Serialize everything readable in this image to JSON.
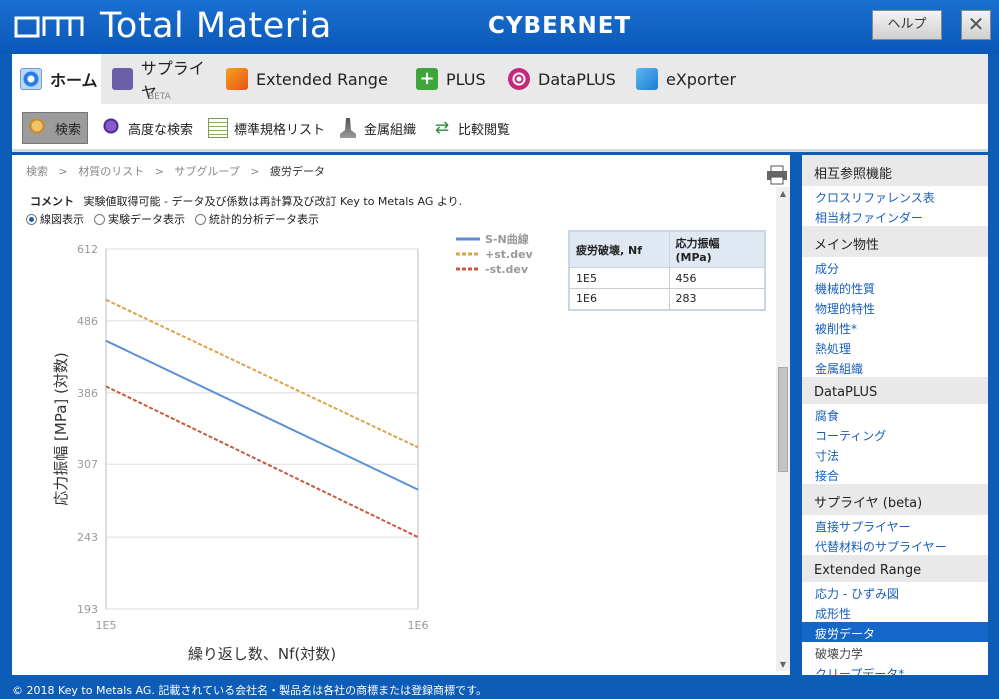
{
  "window": {
    "app_title": "Total Materia",
    "brand": "CYBERNET",
    "help_label": "ヘルプ",
    "close_label": "✕"
  },
  "main_tabs": [
    {
      "label": "ホーム",
      "icon": "home-icon",
      "active": true
    },
    {
      "label": "サプライヤ",
      "icon": "supplier-icon",
      "badge": "BETA"
    },
    {
      "label": "Extended Range",
      "icon": "extended-range-icon"
    },
    {
      "label": "PLUS",
      "icon": "plus-icon"
    },
    {
      "label": "DataPLUS",
      "icon": "dataplus-icon"
    },
    {
      "label": "eXporter",
      "icon": "exporter-icon"
    }
  ],
  "toolbar": [
    {
      "label": "検索",
      "icon": "search-icon",
      "active": true
    },
    {
      "label": "高度な検索",
      "icon": "advanced-search-icon"
    },
    {
      "label": "標準規格リスト",
      "icon": "standards-list-icon"
    },
    {
      "label": "金属組織",
      "icon": "microscope-icon"
    },
    {
      "label": "比較閲覧",
      "icon": "compare-icon"
    }
  ],
  "breadcrumb": [
    "検索",
    "材質のリスト",
    "サブグループ",
    "疲労データ"
  ],
  "comment": {
    "label": "コメント",
    "text": "実験値取得可能 - データ及び係数は再計算及び改訂 Key to Metals AG より."
  },
  "view_options": [
    {
      "label": "線図表示",
      "selected": true
    },
    {
      "label": "実験データ表示",
      "selected": false
    },
    {
      "label": "統計的分析データ表示",
      "selected": false
    }
  ],
  "chart_data": {
    "type": "line",
    "title": "",
    "xlabel": "繰り返し数、Nf(対数)",
    "ylabel": "応力振幅 [MPa] (対数)",
    "x_scale": "log",
    "y_scale": "log",
    "x": [
      "1E5",
      "1E6"
    ],
    "y_ticks": [
      "612",
      "486",
      "386",
      "307",
      "243",
      "193"
    ],
    "ylim": [
      193,
      612
    ],
    "grid": true,
    "legend_position": "top-right",
    "series": [
      {
        "name": "S-N曲線",
        "values": [
          456,
          283
        ],
        "color": "#5b8fd8",
        "dash": "solid"
      },
      {
        "name": "+st.dev",
        "values": [
          520,
          324
        ],
        "color": "#d9a54a",
        "dash": "dashed"
      },
      {
        "name": "-st.dev",
        "values": [
          394,
          243
        ],
        "color": "#c85a3c",
        "dash": "dashed"
      }
    ]
  },
  "data_table": {
    "headers": [
      "疲労破壊, Nf",
      "応力振幅 (MPa)"
    ],
    "rows": [
      [
        "1E5",
        "456"
      ],
      [
        "1E6",
        "283"
      ]
    ]
  },
  "sidebar": [
    {
      "header": "相互参照機能",
      "items": [
        {
          "label": "クロスリファレンス表"
        },
        {
          "label": "相当材ファインダー"
        }
      ]
    },
    {
      "header": "メイン物性",
      "items": [
        {
          "label": "成分"
        },
        {
          "label": "機械的性質"
        },
        {
          "label": "物理的特性"
        },
        {
          "label": "被削性*"
        },
        {
          "label": "熱処理"
        },
        {
          "label": "金属組織"
        }
      ]
    },
    {
      "header": "DataPLUS",
      "items": [
        {
          "label": "腐食"
        },
        {
          "label": "コーティング"
        },
        {
          "label": "寸法"
        },
        {
          "label": "接合"
        }
      ]
    },
    {
      "header": "サプライヤ (beta)",
      "items": [
        {
          "label": "直接サプライヤー"
        },
        {
          "label": "代替材料のサプライヤー"
        }
      ]
    },
    {
      "header": "Extended Range",
      "items": [
        {
          "label": "応力 - ひずみ図"
        },
        {
          "label": "成形性"
        },
        {
          "label": "疲労データ",
          "selected": true
        },
        {
          "label": "破壊力学",
          "muted": true
        },
        {
          "label": "クリープデータ*"
        }
      ]
    }
  ],
  "footer": "© 2018 Key to Metals AG. 記載されている会社名・製品名は各社の商標または登録商標です。"
}
